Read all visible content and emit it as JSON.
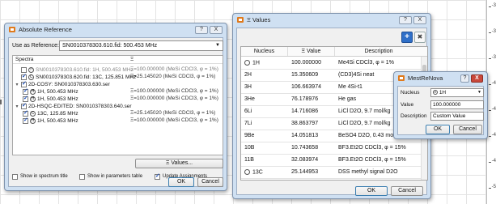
{
  "ruler_ticks": [
    "-3",
    "-3",
    "-3",
    "-4",
    "-4",
    "-4",
    "-4",
    "-5"
  ],
  "abs_ref": {
    "title": "Absolute Reference",
    "help": "?",
    "close": "X",
    "use_as_label": "Use as Reference:",
    "use_as_value": "SN0010378303.610.fid: 500.453 MHz",
    "col_spectra": "Spectra",
    "col_xi": "Ξ",
    "tree": [
      {
        "text": "SN0010378303.610.fid: 1H, 500.453 MHz",
        "xi": "Ξ=100.000000 (MeSi CDCl3, φ = 1%)"
      },
      {
        "text": "SN0010378303.620.fid: 13C, 125.851 MHz",
        "xi": "Ξ=25.145020 (MeSi CDCl3, φ = 1%)"
      },
      {
        "text": "2D-COSY: SN0010378303.630.ser",
        "xi": ""
      },
      {
        "text": "1H, 500.453 MHz",
        "xi": "Ξ=100.000000 (MeSi CDCl3, φ = 1%)"
      },
      {
        "text": "1H, 500.453 MHz",
        "xi": "Ξ=100.000000 (MeSi CDCl3, φ = 1%)"
      },
      {
        "text": "2D-HSQC-EDITED: SN0010378303.640.ser",
        "xi": ""
      },
      {
        "text": "13C, 125.85 MHz",
        "xi": "Ξ=25.145020 (MeSi CDCl3, φ = 1%)"
      },
      {
        "text": "1H, 500.453 MHz",
        "xi": "Ξ=100.000000 (MeSi CDCl3, φ = 1%)"
      }
    ],
    "xi_values_btn": "Ξ Values...",
    "show_title": "Show in spectrum title",
    "show_table": "Show in parameters table",
    "update_assign": "Update Assignments",
    "ok": "OK",
    "cancel": "Cancel"
  },
  "xi_values": {
    "title": "Ξ Values",
    "help": "?",
    "close": "X",
    "add_icon": "+",
    "delete_icon": "✖",
    "headers": [
      "Nucleus",
      "Ξ Value",
      "Description"
    ],
    "rows": [
      {
        "nucleus": "1H",
        "value": "100.000000",
        "desc": "Me4Si CDCl3, φ = 1%"
      },
      {
        "nucleus": "2H",
        "value": "15.350609",
        "desc": "(CD3)4Si neat"
      },
      {
        "nucleus": "3H",
        "value": "106.663974",
        "desc": "Me 4Si-t1"
      },
      {
        "nucleus": "3He",
        "value": "76.178976",
        "desc": "He gas"
      },
      {
        "nucleus": "6Li",
        "value": "14.716086",
        "desc": "LiCl D2O, 9.7 mol/kg"
      },
      {
        "nucleus": "7Li",
        "value": "38.863797",
        "desc": "LiCl D2O, 9.7 mol/kg"
      },
      {
        "nucleus": "9Be",
        "value": "14.051813",
        "desc": "BeSO4 D2O, 0.43 mol/kg"
      },
      {
        "nucleus": "10B",
        "value": "10.743658",
        "desc": "BF3.Et2O CDCl3, φ = 15%"
      },
      {
        "nucleus": "11B",
        "value": "32.083974",
        "desc": "BF3.Et2O CDCl3, φ = 15%"
      },
      {
        "nucleus": "13C",
        "value": "25.144953",
        "desc": "DSS methyl signal D2O"
      }
    ],
    "ok": "OK",
    "cancel": "Cancel"
  },
  "mrn": {
    "title": "MestReNova",
    "help": "?",
    "close": "X",
    "nucleus_label": "Nucleus",
    "nucleus_value": "1H",
    "value_label": "Value",
    "value_value": "100.000000",
    "desc_label": "Description",
    "desc_value": "Custom Value",
    "ok": "OK",
    "cancel": "Cancel"
  }
}
